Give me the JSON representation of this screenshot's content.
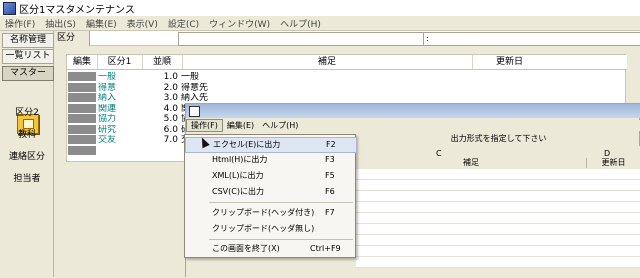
{
  "app": {
    "title": "区分1マスタメンテナンス"
  },
  "menubar": [
    "操作(F)",
    "抽出(S)",
    "編集(E)",
    "表示(V)",
    "設定(C)",
    "ウィンドウ(W)",
    "ヘルプ(H)"
  ],
  "leftnav": {
    "btn_admin": "名称管理",
    "btn_list": "一覧リスト",
    "btn_master": "マスター",
    "item_kubun2": "区分2",
    "item_kyouka": "教科",
    "item_renraku": "連絡区分",
    "item_tanto": "担当者"
  },
  "filter": {
    "label": "区分",
    "field2": ":"
  },
  "grid": {
    "headers": {
      "edit": "編集",
      "code": "区分1",
      "order": "並順",
      "remarks": "補足",
      "updated": "更新日"
    },
    "rows": [
      {
        "code": "一般",
        "order": "1.0",
        "name": "一般"
      },
      {
        "code": "得意",
        "order": "2.0",
        "name": "得意先"
      },
      {
        "code": "納入",
        "order": "3.0",
        "name": "納入先"
      },
      {
        "code": "関連",
        "order": "4.0",
        "name": "関"
      },
      {
        "code": "協力",
        "order": "5.0",
        "name": "協"
      },
      {
        "code": "研究",
        "order": "6.0",
        "name": "研"
      },
      {
        "code": "交友",
        "order": "7.0",
        "name": "交"
      }
    ]
  },
  "subwindow": {
    "menu": {
      "ops": "操作(F)",
      "edit": "編集(E)",
      "help": "ヘルプ(H)"
    },
    "prompt": "出力形式を指定して下さい",
    "col_letters": {
      "c": "C",
      "d": "D"
    },
    "headers": {
      "remarks": "補足",
      "updated": "更新日"
    }
  },
  "dropdown": {
    "items": [
      {
        "label": "エクセル(E)に出力",
        "key": "F2"
      },
      {
        "label": "Html(H)に出力",
        "key": "F3"
      },
      {
        "label": "XML(L)に出力",
        "key": "F5"
      },
      {
        "label": "CSV(C)に出力",
        "key": "F6"
      },
      {
        "label": "クリップボード(ヘッダ付き)",
        "key": "F7"
      },
      {
        "label": "クリップボード(ヘッダ無し)",
        "key": ""
      },
      {
        "label": "この画面を終了(X)",
        "key": "Ctrl+F9"
      }
    ]
  },
  "colors": {
    "accent_teal": "#008080",
    "highlight": "#dfe6f3",
    "title_gradient": "#9fb6d9"
  }
}
